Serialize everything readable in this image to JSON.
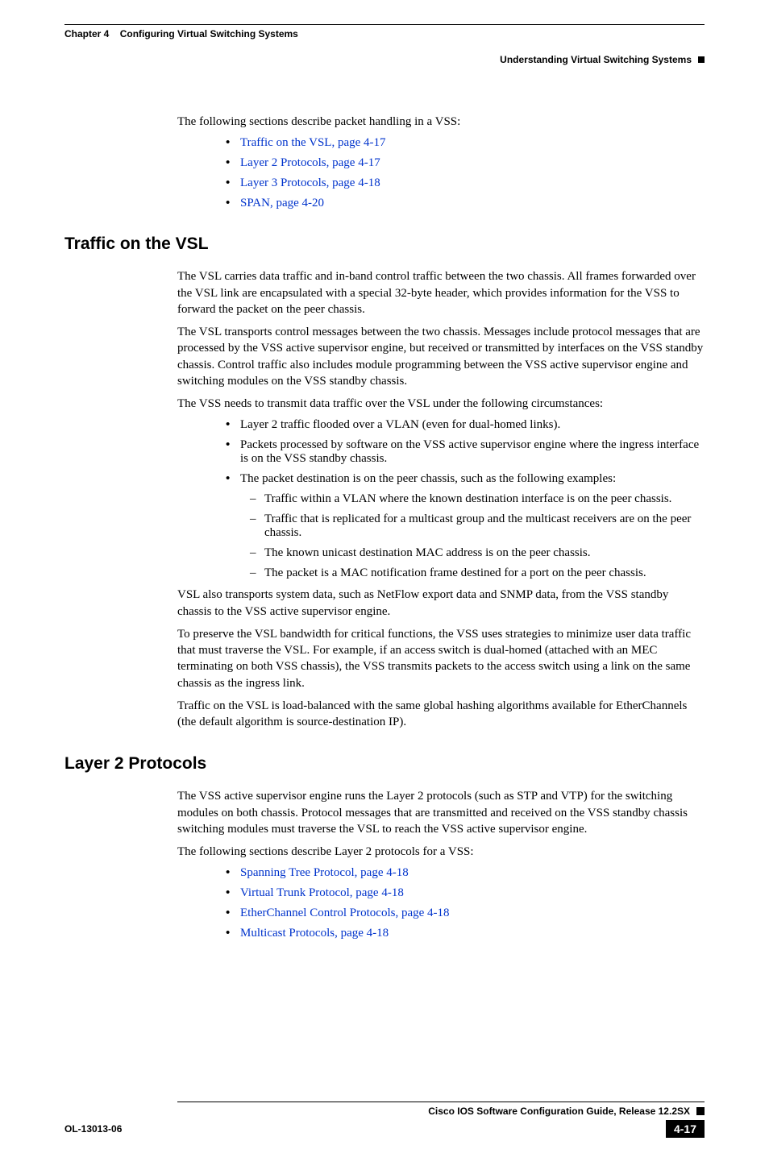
{
  "header": {
    "chapter_label": "Chapter 4",
    "chapter_title": "Configuring Virtual Switching Systems",
    "section_title": "Understanding Virtual Switching Systems"
  },
  "intro": {
    "para": "The following sections describe packet handling in a VSS:",
    "links": [
      "Traffic on the VSL, page 4-17",
      "Layer 2 Protocols, page 4-17",
      "Layer 3 Protocols, page 4-18",
      "SPAN, page 4-20"
    ]
  },
  "section1": {
    "title": "Traffic on the VSL",
    "p1": "The VSL carries data traffic and in-band control traffic between the two chassis. All frames forwarded over the VSL link are encapsulated with a special 32-byte header, which provides information for the VSS to forward the packet on the peer chassis.",
    "p2": "The VSL transports control messages between the two chassis. Messages include protocol messages that are processed by the VSS active supervisor engine, but received or transmitted by interfaces on the VSS standby chassis. Control traffic also includes module programming between the VSS active supervisor engine and switching modules on the VSS standby chassis.",
    "p3": "The VSS needs to transmit data traffic over the VSL under the following circumstances:",
    "bullets": [
      "Layer 2 traffic flooded over a VLAN (even for dual-homed links).",
      "Packets processed by software on the VSS active supervisor engine where the ingress interface is on the VSS standby chassis.",
      "The packet destination is on the peer chassis, such as the following examples:"
    ],
    "subbullets": [
      "Traffic within a VLAN where the known destination interface is on the peer chassis.",
      "Traffic that is replicated for a multicast group and the multicast receivers are on the peer chassis.",
      "The known unicast destination MAC address is on the peer chassis.",
      "The packet is a MAC notification frame destined for a port on the peer chassis."
    ],
    "p4": "VSL also transports system data, such as NetFlow export data and SNMP data, from the VSS standby chassis to the VSS active supervisor engine.",
    "p5": "To preserve the VSL bandwidth for critical functions, the VSS uses strategies to minimize user data traffic that must traverse the VSL. For example, if an access switch is dual-homed (attached with an MEC terminating on both VSS chassis), the VSS transmits packets to the access switch using a link on the same chassis as the ingress link.",
    "p6": "Traffic on the VSL is load-balanced with the same global hashing algorithms available for EtherChannels (the default algorithm is source-destination IP)."
  },
  "section2": {
    "title": "Layer 2 Protocols",
    "p1": "The VSS active supervisor engine runs the Layer 2 protocols (such as STP and VTP) for the switching modules on both chassis. Protocol messages that are transmitted and received on the VSS standby chassis switching modules must traverse the VSL to reach the VSS active supervisor engine.",
    "p2": "The following sections describe Layer 2 protocols for a VSS:",
    "links": [
      "Spanning Tree Protocol, page 4-18",
      "Virtual Trunk Protocol, page 4-18",
      "EtherChannel Control Protocols, page 4-18",
      "Multicast Protocols, page 4-18"
    ]
  },
  "footer": {
    "guide_title": "Cisco IOS Software Configuration Guide, Release 12.2SX",
    "doc_id": "OL-13013-06",
    "page_num": "4-17"
  }
}
